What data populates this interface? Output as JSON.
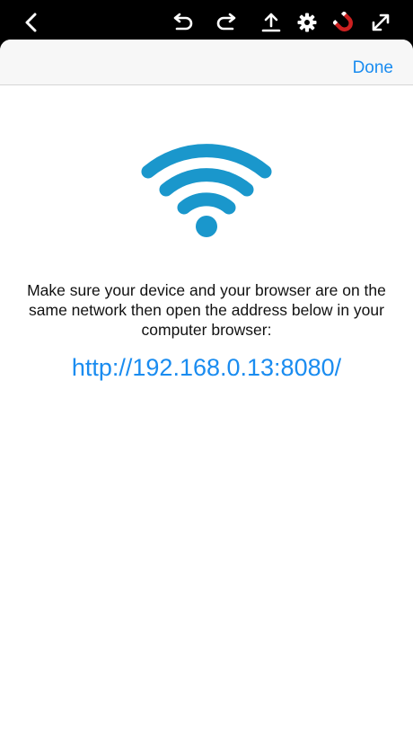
{
  "toolbar": {
    "icons": [
      "back-icon",
      "undo-icon",
      "redo-icon",
      "upload-icon",
      "gear-icon",
      "magnet-icon",
      "fullscreen-icon"
    ]
  },
  "sheet": {
    "done_label": "Done",
    "wifi_icon": "wifi-icon",
    "message": "Make sure your device and your browser are on the same network then open the address below in your computer browser:",
    "address": "http://192.168.0.13:8080/"
  },
  "colors": {
    "accent": "#1a8cf0",
    "wifi": "#1a97cc",
    "magnet_red": "#cc2020"
  }
}
